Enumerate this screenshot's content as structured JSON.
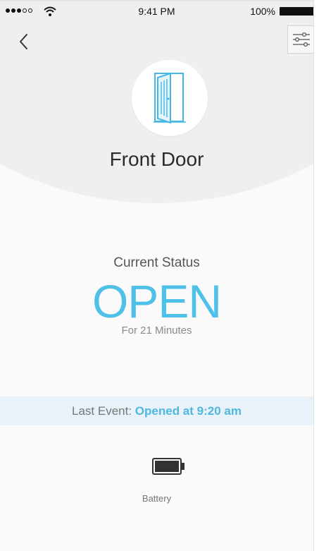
{
  "status_bar": {
    "time": "9:41 PM",
    "battery_percent": "100%"
  },
  "device": {
    "name": "Front Door",
    "icon": "door-open-icon"
  },
  "status": {
    "label": "Current Status",
    "value": "OPEN",
    "duration": "For 21 Minutes"
  },
  "last_event": {
    "label": "Last Event: ",
    "value": "Opened at 9:20 am"
  },
  "battery": {
    "label": "Battery",
    "icon": "battery-icon"
  },
  "colors": {
    "accent": "#4fc1e8",
    "event_banner": "#e8f2f8"
  }
}
